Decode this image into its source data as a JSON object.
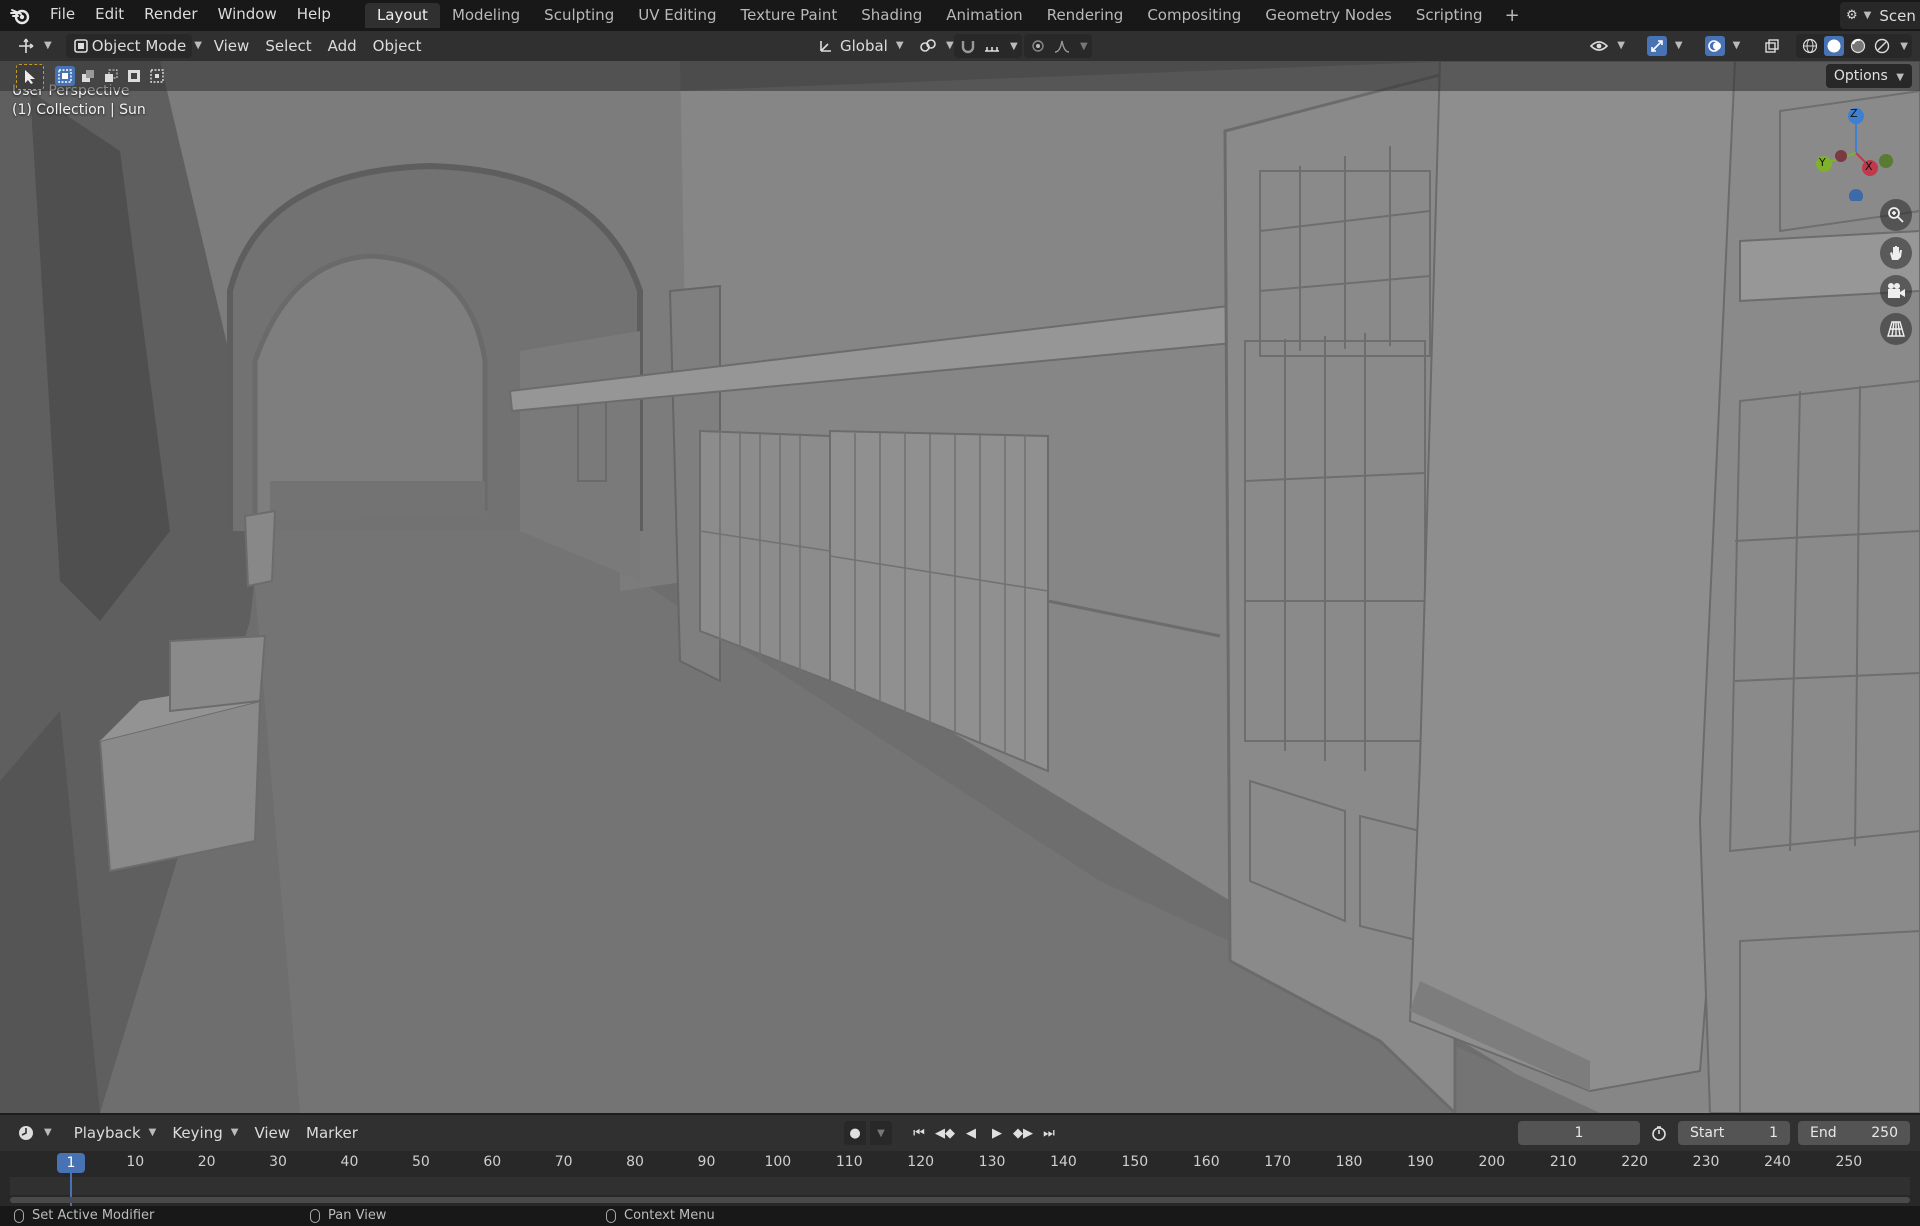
{
  "topbar": {
    "menus": [
      "File",
      "Edit",
      "Render",
      "Window",
      "Help"
    ],
    "workspaces": [
      "Layout",
      "Modeling",
      "Sculpting",
      "UV Editing",
      "Texture Paint",
      "Shading",
      "Animation",
      "Rendering",
      "Compositing",
      "Geometry Nodes",
      "Scripting"
    ],
    "active_workspace": "Layout",
    "add_workspace": "+",
    "scene_label": "Scen"
  },
  "viewport_header": {
    "mode": "Object Mode",
    "menus": [
      "View",
      "Select",
      "Add",
      "Object"
    ],
    "orientation": "Global"
  },
  "tool_row": {
    "options_label": "Options"
  },
  "viewport": {
    "perspective_label": "User Perspective",
    "collection_label": "(1) Collection | Sun",
    "gizmo": {
      "z": "Z",
      "y": "Y",
      "x": "X"
    },
    "colors": {
      "x_axis": "#c0394a",
      "y_axis": "#7fb12b",
      "z_axis": "#3d7fd1"
    }
  },
  "timeline": {
    "menus": [
      "Playback",
      "Keying",
      "View",
      "Marker"
    ],
    "current_frame": "1",
    "start_label": "Start",
    "start_value": "1",
    "end_label": "End",
    "end_value": "250",
    "ruler_current": "1",
    "ruler": [
      "10",
      "20",
      "30",
      "40",
      "50",
      "60",
      "70",
      "80",
      "90",
      "100",
      "110",
      "120",
      "130",
      "140",
      "150",
      "160",
      "170",
      "180",
      "190",
      "200",
      "210",
      "220",
      "230",
      "240",
      "250"
    ]
  },
  "statusbar": {
    "left": "Set Active Modifier",
    "middle": "Pan View",
    "right": "Context Menu"
  }
}
